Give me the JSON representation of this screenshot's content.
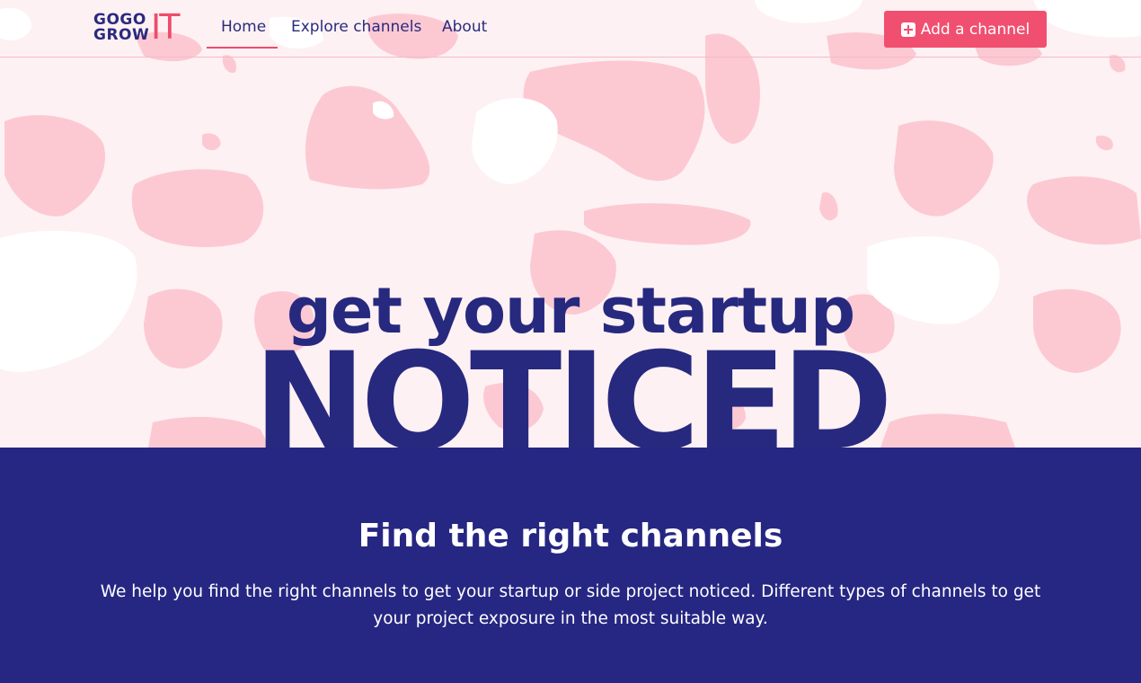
{
  "brand": {
    "logo_top": "GOGO",
    "logo_bottom": "GROW",
    "logo_it": "IT"
  },
  "nav": {
    "items": [
      {
        "label": "Home",
        "active": true
      },
      {
        "label": "Explore channels",
        "active": false
      },
      {
        "label": "About",
        "active": false
      }
    ],
    "cta_label": "Add a channel",
    "cta_icon": "plus-square-icon"
  },
  "hero": {
    "line1": "get your startup",
    "line2": "NOTICED",
    "background": "pink-blob-pattern"
  },
  "section": {
    "title": "Find the right channels",
    "text": "We help you find the right channels to get your startup or side project noticed. Different types of channels to get your project exposure in the most suitable way."
  },
  "colors": {
    "navy": "#262683",
    "pink_accent": "#f14f70",
    "blob_pink": "#fcc8d2",
    "hero_bg": "#fdf1f3"
  }
}
